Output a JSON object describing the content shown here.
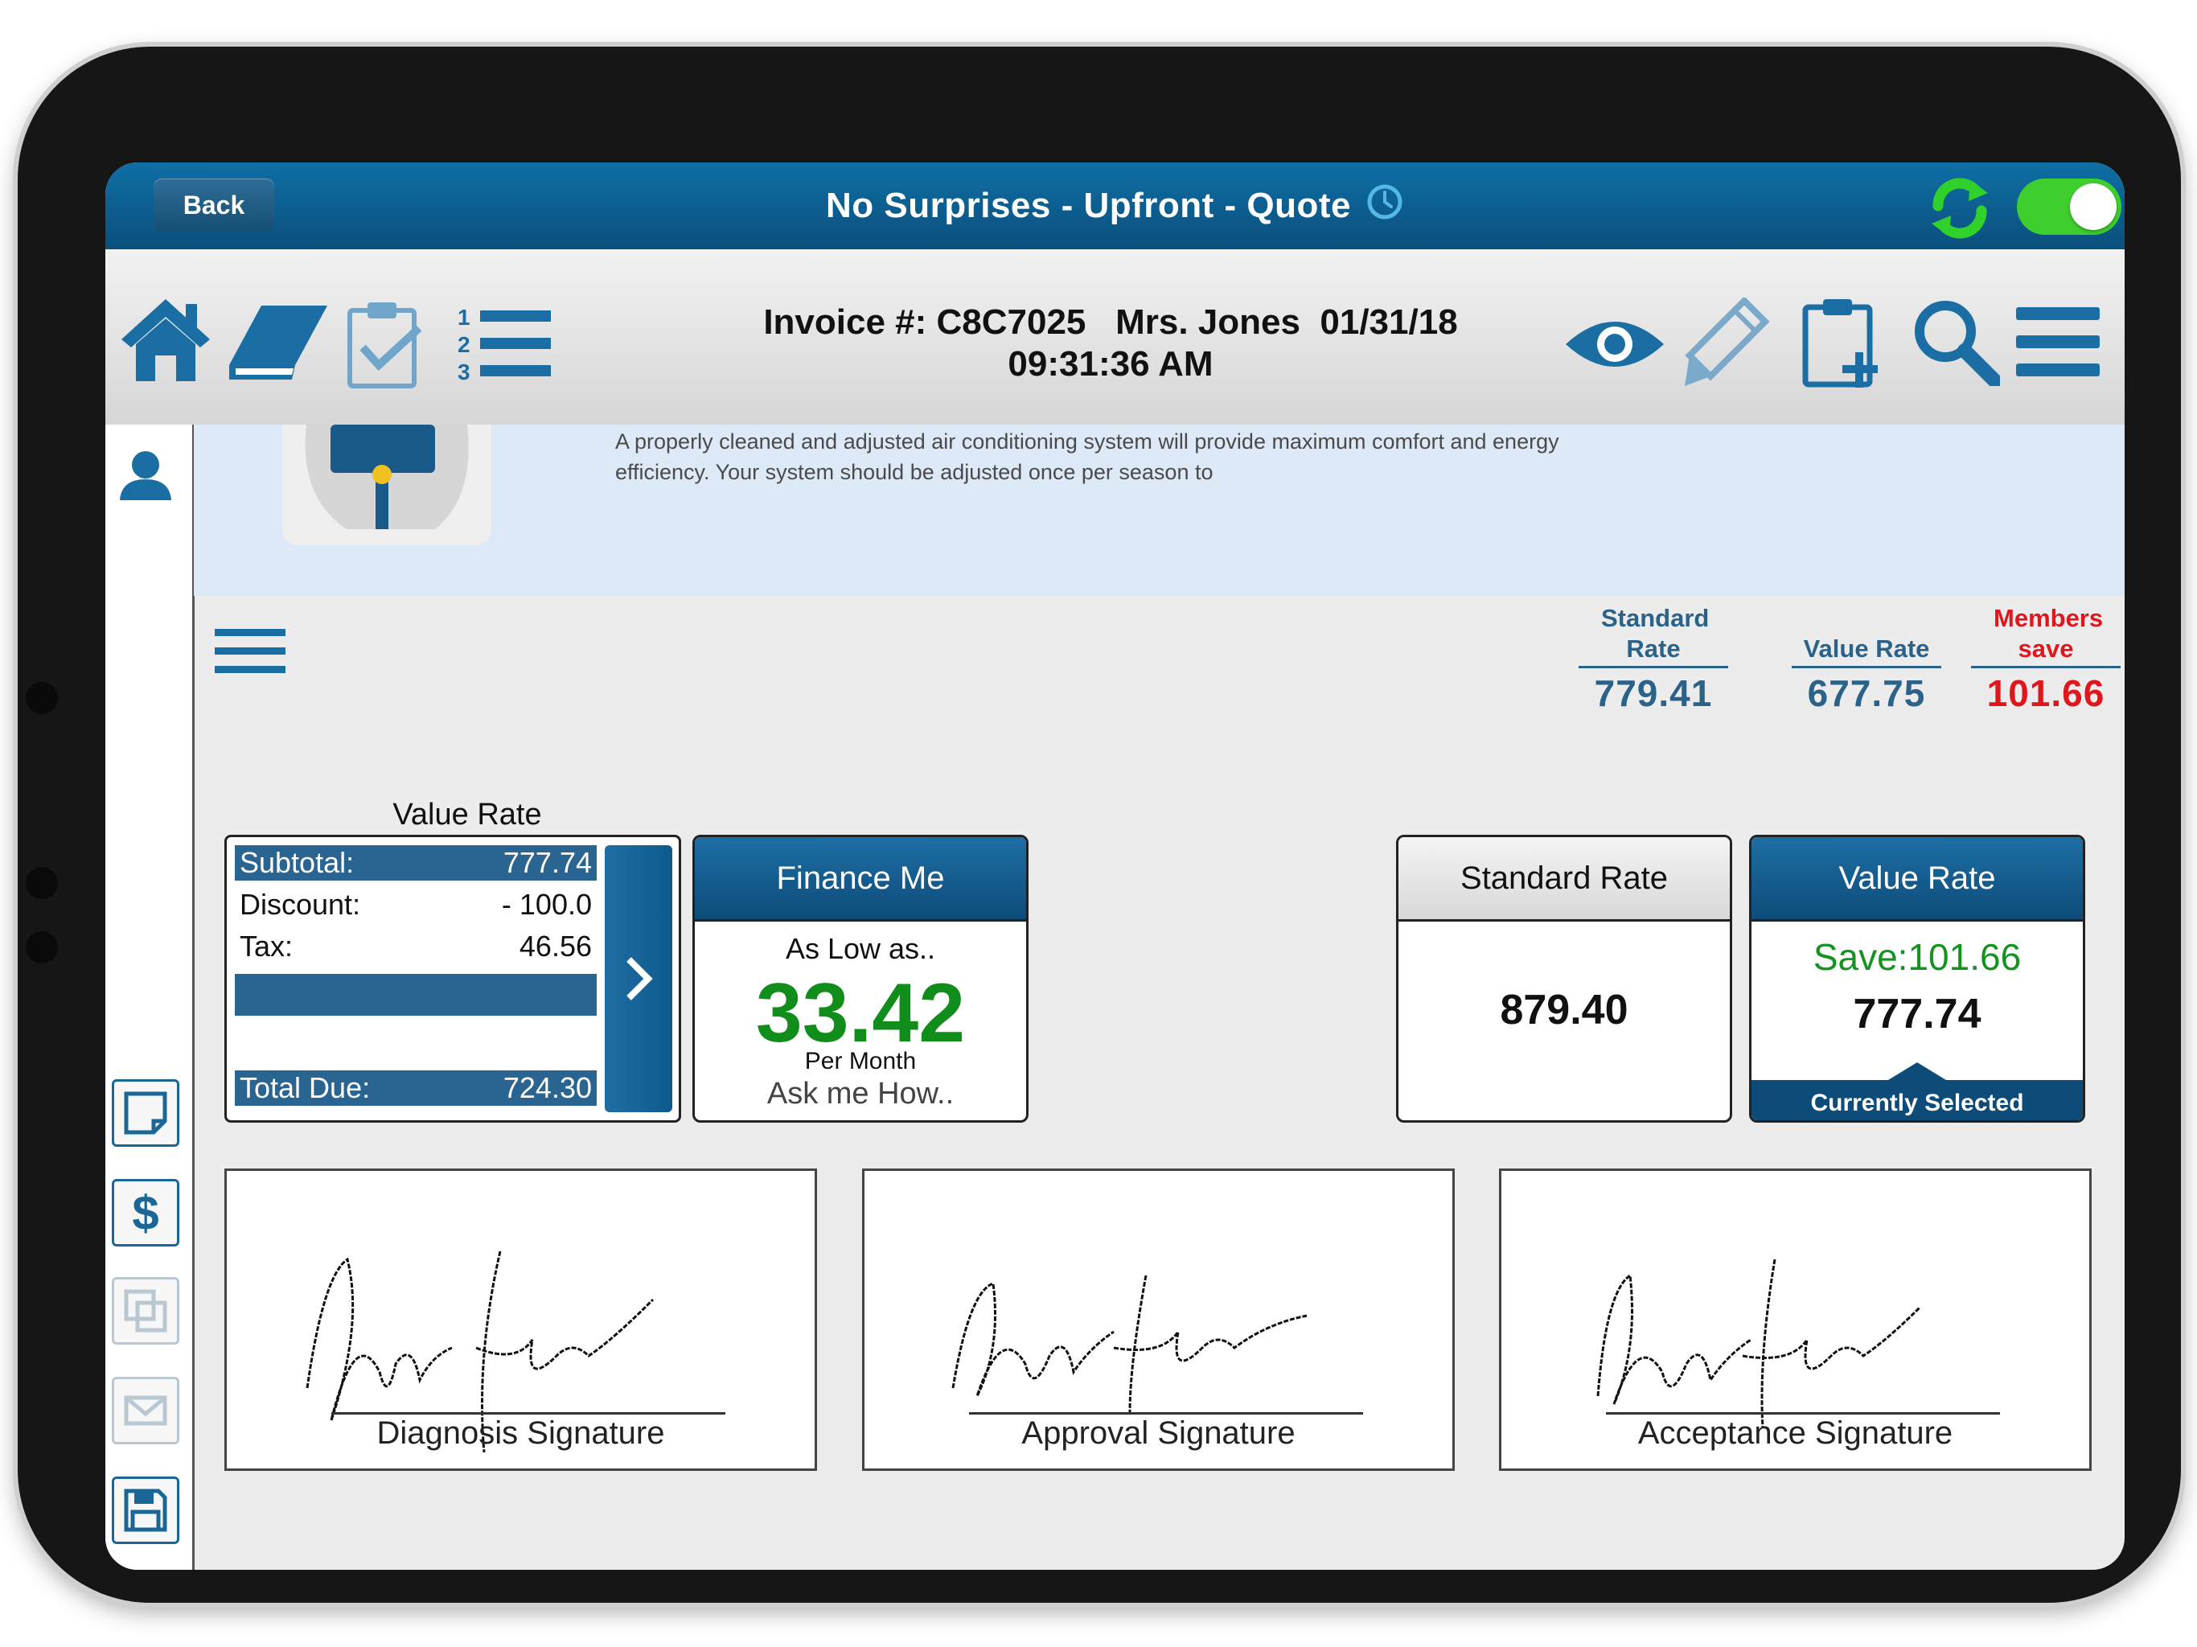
{
  "titlebar": {
    "back_label": "Back",
    "title": "No Surprises - Upfront - Quote",
    "toggle_on": true
  },
  "toolbar": {
    "invoice_line1": "Invoice #: C8C7025   Mrs. Jones  01/31/18",
    "invoice_line2": "09:31:36 AM",
    "left_icons": [
      "home-icon",
      "book-icon",
      "clipboard-check-icon",
      "numbered-list-icon"
    ],
    "right_icons": [
      "eye-icon",
      "pencil-icon",
      "clipboard-add-icon",
      "search-icon",
      "menu-icon"
    ]
  },
  "description": {
    "text": "A properly cleaned and adjusted air conditioning system will provide maximum comfort and energy efficiency. Your system should be adjusted once per season to"
  },
  "rates_header": {
    "standard_label": "Standard Rate",
    "standard_value": "779.41",
    "value_label": "Value Rate",
    "value_value": "677.75",
    "members_label": "Members save",
    "members_value": "101.66"
  },
  "summary": {
    "caption": "Value Rate",
    "subtotal_label": "Subtotal:",
    "subtotal_value": "777.74",
    "discount_label": "Discount:",
    "discount_value": "- 100.0",
    "tax_label": "Tax:",
    "tax_value": "46.56",
    "total_label": "Total Due:",
    "total_value": "724.30"
  },
  "finance": {
    "title": "Finance Me",
    "as_low": "As Low as..",
    "amount": "33.42",
    "per_month": "Per Month",
    "ask": "Ask me How.."
  },
  "standard_card": {
    "title": "Standard Rate",
    "value": "879.40"
  },
  "value_card": {
    "title": "Value Rate",
    "save": "Save:101.66",
    "value": "777.74",
    "selected": "Currently Selected"
  },
  "signatures": [
    {
      "label": "Diagnosis Signature"
    },
    {
      "label": "Approval Signature"
    },
    {
      "label": "Acceptance Signature"
    }
  ],
  "left_rail": [
    "user-icon",
    "note-icon",
    "dollar-icon",
    "copy-icon",
    "mail-icon",
    "save-icon"
  ],
  "colors": {
    "brand_blue": "#0f5a8c",
    "accent_green": "#118d1b",
    "members_red": "#e0161d"
  }
}
